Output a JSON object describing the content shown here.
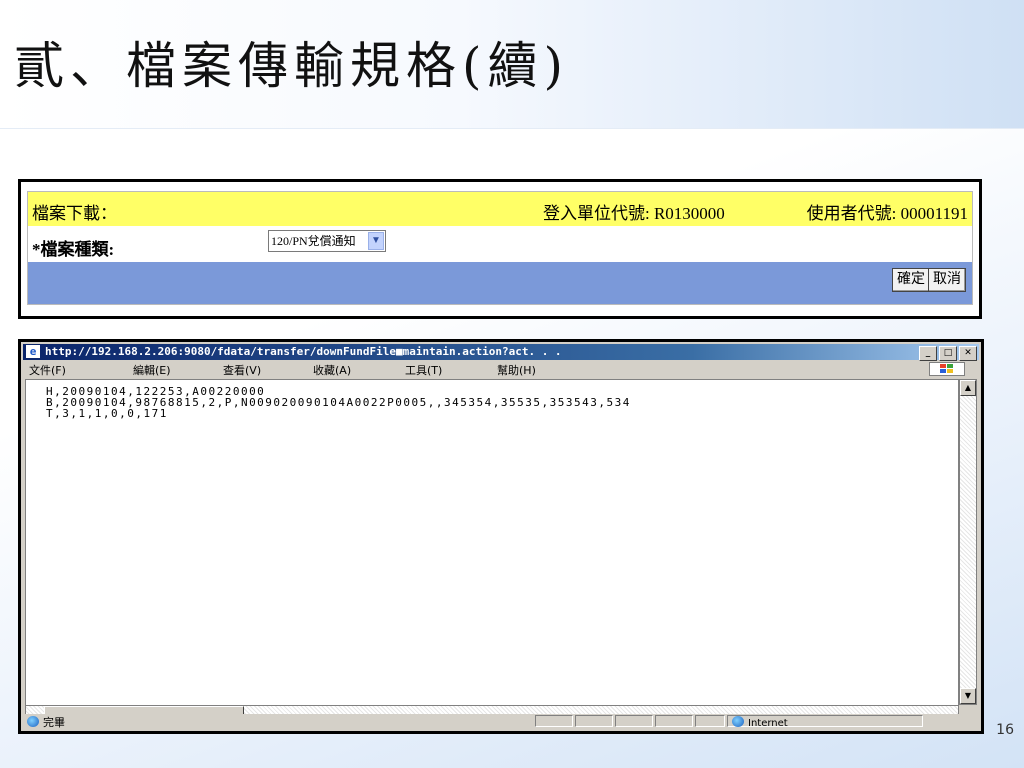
{
  "slide": {
    "title": "貳、檔案傳輸規格(續)",
    "page_number": "16"
  },
  "form": {
    "header_left": "檔案下載：",
    "login_unit": "登入單位代號: R0130000",
    "user_code": "使用者代號: 00001191",
    "file_type_label": "*檔案種類:",
    "file_type_selected": "120/PN兌償通知",
    "confirm_label": "確定",
    "cancel_label": "取消"
  },
  "browser": {
    "title": "http://192.168.2.206:9080/fdata/transfer/downFundFile■maintain.action?act. . .",
    "menu": [
      "文件(F)",
      "編輯(E)",
      "查看(V)",
      "收藏(A)",
      "工具(T)",
      "幫助(H)"
    ],
    "content_lines": [
      "H,20090104,122253,A00220000",
      "B,20090104,98768815,2,P,N009020090104A0022P0005,,345354,35535,353543,534",
      "T,3,1,1,0,0,171"
    ],
    "status_text": "完畢",
    "zone_text": "Internet"
  },
  "colors": {
    "header_yellow": "#ffff66",
    "action_blue": "#7b99d9",
    "titlebar_blue": "#0a246a"
  }
}
